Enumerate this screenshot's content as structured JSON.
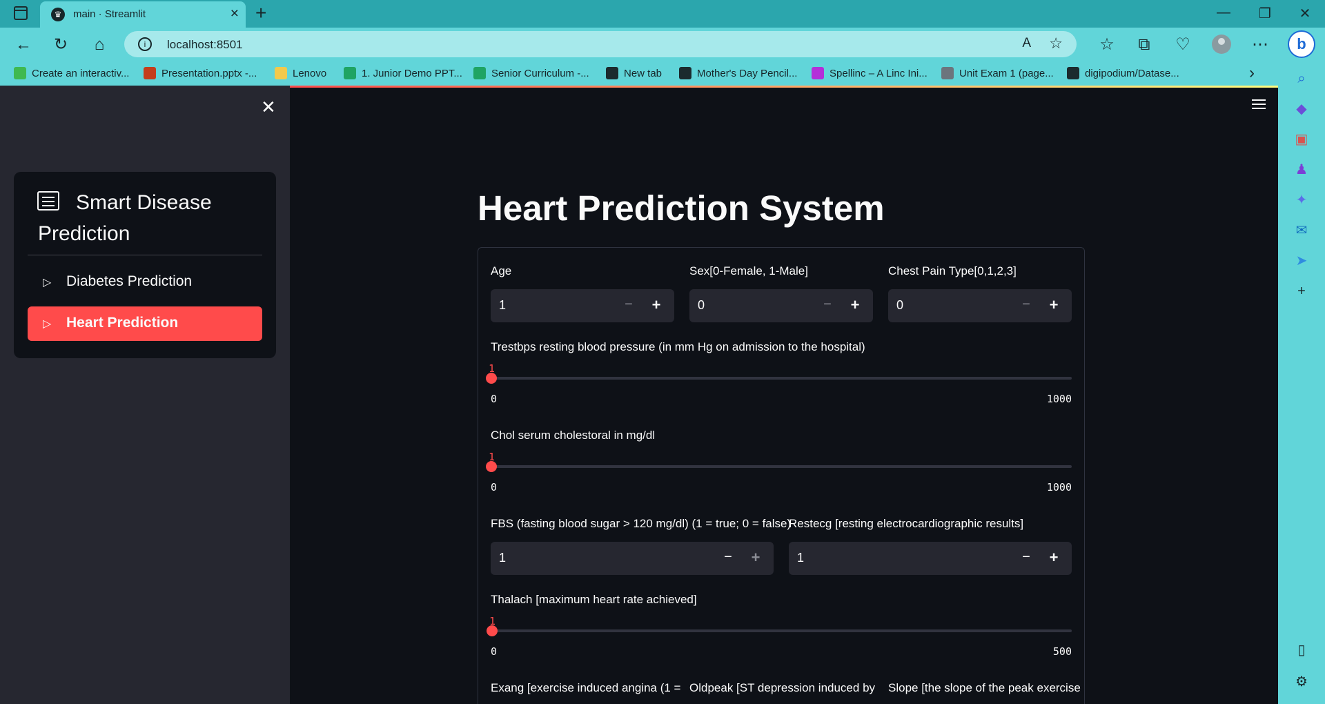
{
  "browser": {
    "tab_title": "main · Streamlit",
    "tab_favicon": "streamlit-crown-icon",
    "url": "localhost:8501",
    "bookmarks": [
      {
        "label": "Create an interactiv...",
        "color": "#3fb950"
      },
      {
        "label": "Presentation.pptx -...",
        "color": "#c43e1c"
      },
      {
        "label": "Lenovo",
        "color": "#f2c94c"
      },
      {
        "label": "1. Junior Demo PPT...",
        "color": "#1fa463"
      },
      {
        "label": "Senior Curriculum -...",
        "color": "#1fa463"
      },
      {
        "label": "New tab",
        "color": "#1b2b2e"
      },
      {
        "label": "Mother's Day Pencil...",
        "color": "#1b2b2e"
      },
      {
        "label": "Spellinc – A Linc Ini...",
        "color": "#b42fd9"
      },
      {
        "label": "Unit Exam 1 (page...",
        "color": "#6c757d"
      },
      {
        "label": "digipodium/Datase...",
        "color": "#1b2b2e"
      }
    ]
  },
  "sidebar": {
    "menu_title": "Smart Disease Prediction",
    "items": [
      {
        "label": "Diabetes Prediction",
        "active": false
      },
      {
        "label": "Heart Prediction",
        "active": true
      }
    ]
  },
  "main": {
    "title": "Heart Prediction System",
    "fields": {
      "age": {
        "label": "Age",
        "value": "1"
      },
      "sex": {
        "label": "Sex[0-Female, 1-Male]",
        "value": "0"
      },
      "cp": {
        "label": "Chest Pain Type[0,1,2,3]",
        "value": "0"
      },
      "trestbps": {
        "label": "Trestbps resting blood pressure (in mm Hg on admission to the hospital)",
        "value": 1,
        "min": 0,
        "max": 1000,
        "value_text": "1",
        "min_text": "0",
        "max_text": "1000"
      },
      "chol": {
        "label": "Chol serum cholestoral in mg/dl",
        "value": 1,
        "min": 0,
        "max": 1000,
        "value_text": "1",
        "min_text": "0",
        "max_text": "1000"
      },
      "fbs": {
        "label": "FBS (fasting blood sugar > 120 mg/dl) (1 = true; 0 = false)",
        "value": "1"
      },
      "restecg": {
        "label": "Restecg [resting electrocardiographic results]",
        "value": "1"
      },
      "thalach": {
        "label": "Thalach [maximum heart rate achieved]",
        "value": 1,
        "min": 0,
        "max": 500,
        "value_text": "1",
        "min_text": "0",
        "max_text": "500"
      },
      "exang": {
        "label": "Exang [exercise induced angina (1 ="
      },
      "oldpeak": {
        "label": "Oldpeak [ST depression induced by"
      },
      "slope": {
        "label": "Slope [the slope of the peak exercise"
      }
    }
  },
  "colors": {
    "accent": "#ff4b4b",
    "background": "#0e1117",
    "sidebar": "#262730",
    "browser_chrome": "#61d5d9"
  }
}
